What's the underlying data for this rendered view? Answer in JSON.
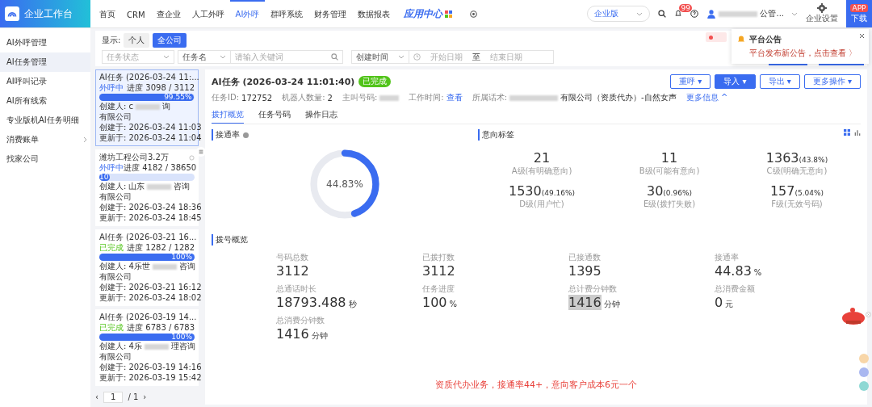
{
  "brand": "企业工作台",
  "nav": [
    {
      "label": "首页",
      "selected": false
    },
    {
      "label": "CRM",
      "selected": false
    },
    {
      "label": "查企业",
      "selected": false
    },
    {
      "label": "人工外呼",
      "selected": false
    },
    {
      "label": "AI外呼",
      "selected": true
    },
    {
      "label": "群呼系统",
      "selected": false
    },
    {
      "label": "财务管理",
      "selected": false
    },
    {
      "label": "数据报表",
      "selected": false
    }
  ],
  "app_center": "应用中心",
  "header_right": {
    "edition": "企业版",
    "notifications": "99",
    "user": "公管...",
    "settings": "企业设置",
    "app_badge": "APP",
    "download": "下载"
  },
  "sidebar": [
    {
      "label": "AI外呼管理",
      "selected": false
    },
    {
      "label": "AI任务管理",
      "selected": true
    },
    {
      "label": "AI呼叫记录",
      "selected": false
    },
    {
      "label": "AI所有线索",
      "selected": false
    },
    {
      "label": "专业版机AI任务明细",
      "selected": false
    },
    {
      "label": "消费账单",
      "selected": false,
      "expandable": true
    },
    {
      "label": "找家公司",
      "selected": false
    }
  ],
  "filters": {
    "show_label": "显示:",
    "scopes": [
      {
        "label": "个人",
        "selected": false
      },
      {
        "label": "全公司",
        "selected": true
      }
    ],
    "status_placeholder": "任务状态",
    "name_select": "任务名",
    "keyword_placeholder": "请输入关键词",
    "time_select": "创建时间",
    "start_placeholder": "开始日期",
    "to": "至",
    "end_placeholder": "结束日期"
  },
  "notice": {
    "title": "平台公告",
    "text": "平台发布新公告，点击查看 〉"
  },
  "tasks": [
    {
      "title": "AI任务 (2026-03-24 11:...",
      "status": "外呼中",
      "kind": "running",
      "progress": "进度 3098 / 3112",
      "level": 0.9955,
      "percent": "99.55%",
      "creator_label": "创建人:",
      "creator_prefix": "c",
      "creator_tail": "询",
      "creator_line2": "有限公司",
      "created_label": "创建于:",
      "created": "2026-03-24 11:03",
      "updated_label": "更新于:",
      "updated": "2026-03-24 11:04",
      "selected": true
    },
    {
      "title": "潍坊工程公司3.2万",
      "status": "外呼中",
      "kind": "running",
      "progress": "进度 4182 / 38650",
      "level": 0.108,
      "percent": "10",
      "creator_label": "创建人:",
      "creator_prefix": "山东",
      "creator_tail": "咨询",
      "creator_line2": "有限公司",
      "created_label": "创建于:",
      "created": "2026-03-24 18:36",
      "updated_label": "更新于:",
      "updated": "2026-03-24 18:45",
      "selected": false
    },
    {
      "title": "AI任务 (2026-03-21 16...",
      "status": "已完成",
      "kind": "done",
      "progress": "进度 1282 / 1282",
      "level": 1,
      "percent": "100%",
      "creator_label": "创建人:",
      "creator_prefix": "4乐世",
      "creator_tail": "咨询",
      "creator_line2": "有限公司",
      "created_label": "创建于:",
      "created": "2026-03-21 16:12",
      "updated_label": "更新于:",
      "updated": "2026-03-24 18:02",
      "selected": false
    },
    {
      "title": "AI任务 (2026-03-19 14...",
      "status": "已完成",
      "kind": "done",
      "progress": "进度 6783 / 6783",
      "level": 1,
      "percent": "100%",
      "creator_label": "创建人:",
      "creator_prefix": "4乐",
      "creator_tail": "理咨询",
      "creator_line2": "有限公司",
      "created_label": "创建于:",
      "created": "2026-03-19 14:16",
      "updated_label": "更新于:",
      "updated": "2026-03-19 15:42",
      "selected": false
    }
  ],
  "pagination": {
    "prev": "‹",
    "page": "1",
    "total": "/ 1",
    "next": "›"
  },
  "detail": {
    "title": "AI任务 (2026-03-24 11:01:40)",
    "status": "已完成",
    "meta": [
      {
        "label": "任务ID:",
        "value": "172752",
        "kind": "text"
      },
      {
        "label": "机器人数量:",
        "value": "2",
        "kind": "text"
      },
      {
        "label": "主叫号码:",
        "kind": "blurred"
      },
      {
        "label": "工作时间:",
        "value": "查看",
        "kind": "link"
      },
      {
        "label": "所属话术:",
        "value": "有限公司（资质代办）-自然女声",
        "kind": "blurred_prefix"
      }
    ],
    "more_info": "更多信息 ^",
    "buttons": [
      {
        "label": "重呼 ▾",
        "kind": "outline"
      },
      {
        "label": "导入 ▾",
        "kind": "primary"
      },
      {
        "label": "导出 ▾",
        "kind": "outline"
      },
      {
        "label": "更多操作 ▾",
        "kind": "outline"
      }
    ],
    "tabs": [
      {
        "label": "拨打概览",
        "selected": true
      },
      {
        "label": "任务号码",
        "selected": false
      },
      {
        "label": "操作日志",
        "selected": false
      }
    ]
  },
  "connect": {
    "title": "接通率",
    "level": 0.4483,
    "reading": "44.83%"
  },
  "intent": {
    "title": "意向标签",
    "items": [
      {
        "value": "21",
        "label": "A级(有明确意向)"
      },
      {
        "value": "11",
        "label": "B级(可能有意向)"
      },
      {
        "value": "1363",
        "pct": "(43.8%)",
        "label": "C级(明确无意向)"
      },
      {
        "value": "1530",
        "pct": "(49.16%)",
        "label": "D级(用户忙)"
      },
      {
        "value": "30",
        "pct": "(0.96%)",
        "label": "E级(拨打失败)"
      },
      {
        "value": "157",
        "pct": "(5.04%)",
        "label": "F级(无效号码)"
      }
    ]
  },
  "dial": {
    "title": "拨号概览",
    "items": [
      {
        "label": "号码总数",
        "value": "3112",
        "highlight": false
      },
      {
        "label": "已拨打数",
        "value": "3112",
        "highlight": false
      },
      {
        "label": "已接通数",
        "value": "1395",
        "highlight": false
      },
      {
        "label": "接通率",
        "value": "44.83",
        "unit": "%",
        "highlight": false
      },
      {
        "label": "总通话时长",
        "value": "18793.488",
        "unit": "秒",
        "highlight": false
      },
      {
        "label": "任务进度",
        "value": "100",
        "unit": "%",
        "highlight": false
      },
      {
        "label": "总计费分钟数",
        "value": "1416",
        "unit": "分钟",
        "highlight": true
      },
      {
        "label": "总消费金额",
        "value": "0",
        "unit": "元",
        "highlight": false
      },
      {
        "label": "总消费分钟数",
        "value": "1416",
        "unit": "分钟",
        "highlight": false
      }
    ]
  },
  "annotation": "资质代办业务，接通率44+，意向客户成本6元一个"
}
